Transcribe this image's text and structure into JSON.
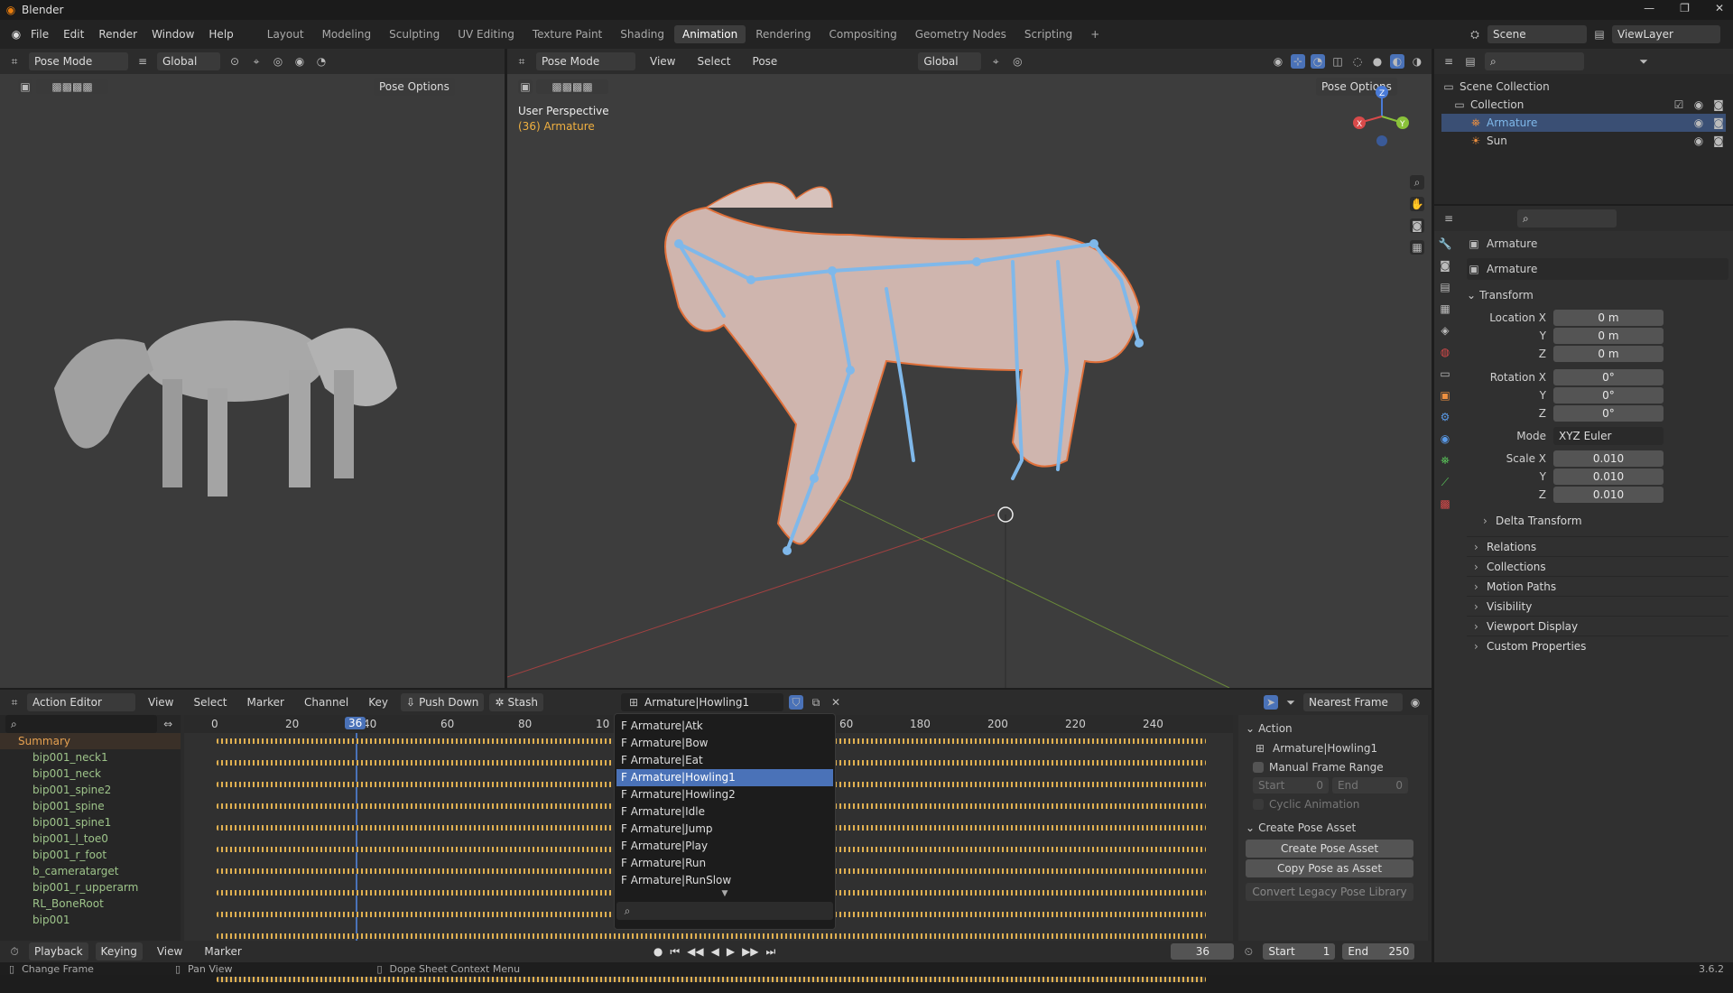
{
  "app": {
    "title": "Blender",
    "version": "3.6.2"
  },
  "menu": [
    "File",
    "Edit",
    "Render",
    "Window",
    "Help"
  ],
  "workspaces": [
    "Layout",
    "Modeling",
    "Sculpting",
    "UV Editing",
    "Texture Paint",
    "Shading",
    "Animation",
    "Rendering",
    "Compositing",
    "Geometry Nodes",
    "Scripting"
  ],
  "active_workspace": "Animation",
  "scene": {
    "name": "Scene",
    "view_layer": "ViewLayer"
  },
  "left_view": {
    "mode": "Pose Mode",
    "orientation": "Global",
    "pose_options": "Pose Options"
  },
  "main_view": {
    "mode": "Pose Mode",
    "orientation": "Global",
    "menus": [
      "View",
      "Select",
      "Pose"
    ],
    "pose_options": "Pose Options",
    "perspective": "User Perspective",
    "object_label": "(36) Armature"
  },
  "outliner": {
    "root": "Scene Collection",
    "collection": "Collection",
    "items": [
      {
        "label": "Armature"
      },
      {
        "label": "Sun"
      }
    ]
  },
  "properties": {
    "object_name": "Armature",
    "data_name": "Armature",
    "transform_title": "Transform",
    "location_label": "Location X",
    "location": [
      "0 m",
      "0 m",
      "0 m"
    ],
    "rotation_label": "Rotation X",
    "rotation": [
      "0°",
      "0°",
      "0°"
    ],
    "mode_label": "Mode",
    "mode": "XYZ Euler",
    "scale_label": "Scale X",
    "scale": [
      "0.010",
      "0.010",
      "0.010"
    ],
    "axis_y": "Y",
    "axis_z": "Z",
    "delta": "Delta Transform",
    "sections": [
      "Relations",
      "Collections",
      "Motion Paths",
      "Visibility",
      "Viewport Display",
      "Custom Properties"
    ]
  },
  "action_editor": {
    "editor": "Action Editor",
    "menus": [
      "View",
      "Select",
      "Marker",
      "Channel",
      "Key"
    ],
    "push_down": "Push Down",
    "stash": "Stash",
    "action": "Armature|Howling1",
    "snap": "Nearest Frame",
    "current_frame": "36",
    "ruler": [
      "0",
      "20",
      "40",
      "60",
      "80",
      "10",
      "60",
      "180",
      "200",
      "220",
      "240"
    ],
    "channels": [
      "Summary",
      "bip001_neck1",
      "bip001_neck",
      "bip001_spine2",
      "bip001_spine",
      "bip001_spine1",
      "bip001_l_toe0",
      "bip001_r_foot",
      "b_cameratarget",
      "bip001_r_upperarm",
      "RL_BoneRoot",
      "bip001"
    ],
    "dropdown": [
      "F Armature|Atk",
      "F Armature|Bow",
      "F Armature|Eat",
      "F Armature|Howling1",
      "F Armature|Howling2",
      "F Armature|Idle",
      "F Armature|Jump",
      "F Armature|Play",
      "F Armature|Run",
      "F Armature|RunSlow"
    ],
    "dropdown_selected": 3
  },
  "action_panel": {
    "title": "Action",
    "action_name": "Armature|Howling1",
    "manual_range": "Manual Frame Range",
    "start_label": "Start",
    "start": "0",
    "end_label": "End",
    "end": "0",
    "cyclic": "Cyclic Animation",
    "pose_asset_title": "Create Pose Asset",
    "create_pose": "Create Pose Asset",
    "copy_pose": "Copy Pose as Asset",
    "convert": "Convert Legacy Pose Library"
  },
  "timeline": {
    "menus": [
      "Playback",
      "Keying",
      "View",
      "Marker"
    ],
    "frame": "36",
    "start_label": "Start",
    "start": "1",
    "end_label": "End",
    "end": "250"
  },
  "status": {
    "left": "Change Frame",
    "mid": "Pan View",
    "right": "Dope Sheet Context Menu"
  },
  "colors": {
    "accent": "#4a72b8",
    "bone": "#7fb8ea",
    "keyframe": "#e0b050",
    "channel": "#9ec48a"
  }
}
